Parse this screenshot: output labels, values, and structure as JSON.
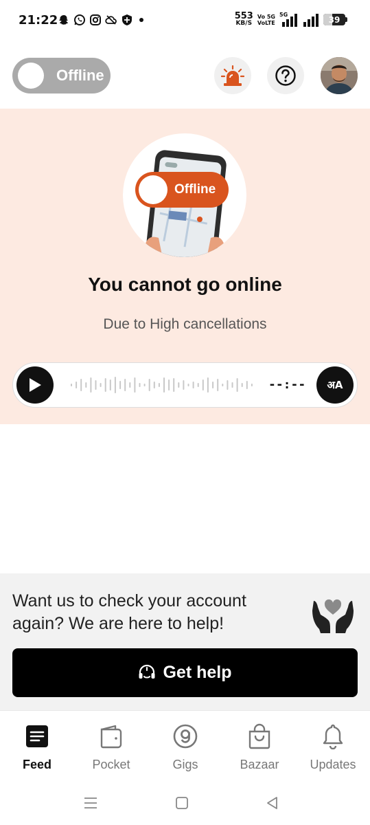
{
  "status_bar": {
    "time": "21:22",
    "net_speed_value": "553",
    "net_speed_unit": "KB/S",
    "volte_line1": "Vo 5G",
    "volte_line2": "VoLTE",
    "signal_label": "5G",
    "battery": "39"
  },
  "header": {
    "toggle_label": "Offline",
    "alarm_icon": "siren-icon",
    "help_icon": "question-icon"
  },
  "banner": {
    "illustration_toggle_label": "Offline",
    "title": "You cannot go online",
    "subtitle": "Due to High cancellations",
    "player": {
      "duration": "--:--",
      "language_label": "अA"
    }
  },
  "help": {
    "text": "Want us to check your account again? We are here to help!",
    "button_label": "Get help"
  },
  "nav": {
    "items": [
      {
        "label": "Feed",
        "icon": "feed-icon",
        "active": true
      },
      {
        "label": "Pocket",
        "icon": "wallet-icon",
        "active": false
      },
      {
        "label": "Gigs",
        "icon": "gigs-icon",
        "active": false
      },
      {
        "label": "Bazaar",
        "icon": "shopping-bag-icon",
        "active": false
      },
      {
        "label": "Updates",
        "icon": "bell-icon",
        "active": false
      }
    ]
  },
  "colors": {
    "banner_bg": "#fdeae1",
    "accent_orange": "#d9541e",
    "toggle_gray": "#aaaaaa",
    "primary_button": "#000000"
  }
}
